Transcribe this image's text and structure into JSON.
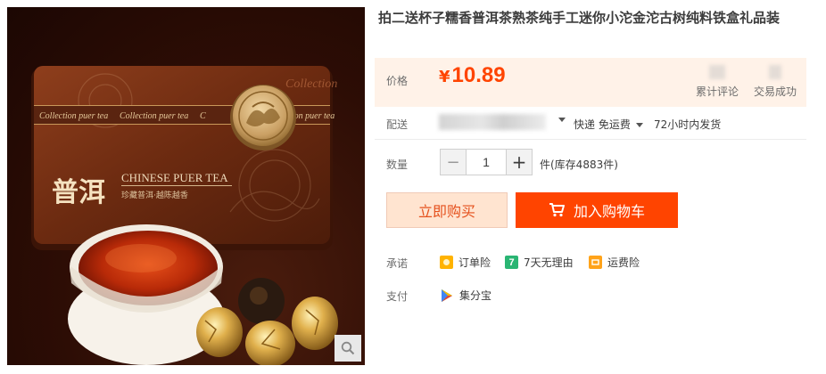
{
  "product": {
    "title": "拍二送杯子糯香普洱茶熟茶纯手工迷你小沱金沱古树纯料铁盒礼品装",
    "image": {
      "tin_text_main": "普洱",
      "tin_text_en": "CHINESE PUER TEA",
      "tin_band_text": "Collection puer tea",
      "tin_corner_text": "Collection",
      "tin_subtext": "珍藏普洱·越陈越香"
    }
  },
  "price": {
    "label": "价格",
    "currency": "¥",
    "value": "10.89"
  },
  "stats": {
    "reviews_label": "累计评论",
    "sales_label": "交易成功"
  },
  "shipping": {
    "label": "配送",
    "method": "快递 免运费",
    "eta": "72小时内发货"
  },
  "quantity": {
    "label": "数量",
    "value": "1",
    "minus": "−",
    "plus": "+",
    "stock": "件(库存4883件)"
  },
  "actions": {
    "buy_now": "立即购买",
    "add_to_cart": "加入购物车"
  },
  "promises": {
    "label": "承诺",
    "items": [
      "订单险",
      "7天无理由",
      "运费险"
    ],
    "seven_icon_text": "7"
  },
  "payment": {
    "label": "支付",
    "method": "集分宝"
  },
  "colors": {
    "accent": "#ff4400",
    "price_bg": "#fff2e8",
    "buy_bg": "#ffe4d0"
  },
  "icons": {
    "zoom": "magnifier-icon",
    "cart": "cart-icon",
    "order_insurance": "order-insurance-icon",
    "seven_day": "seven-day-return-icon",
    "freight": "freight-insurance-icon",
    "jifenbao": "jifenbao-icon"
  }
}
